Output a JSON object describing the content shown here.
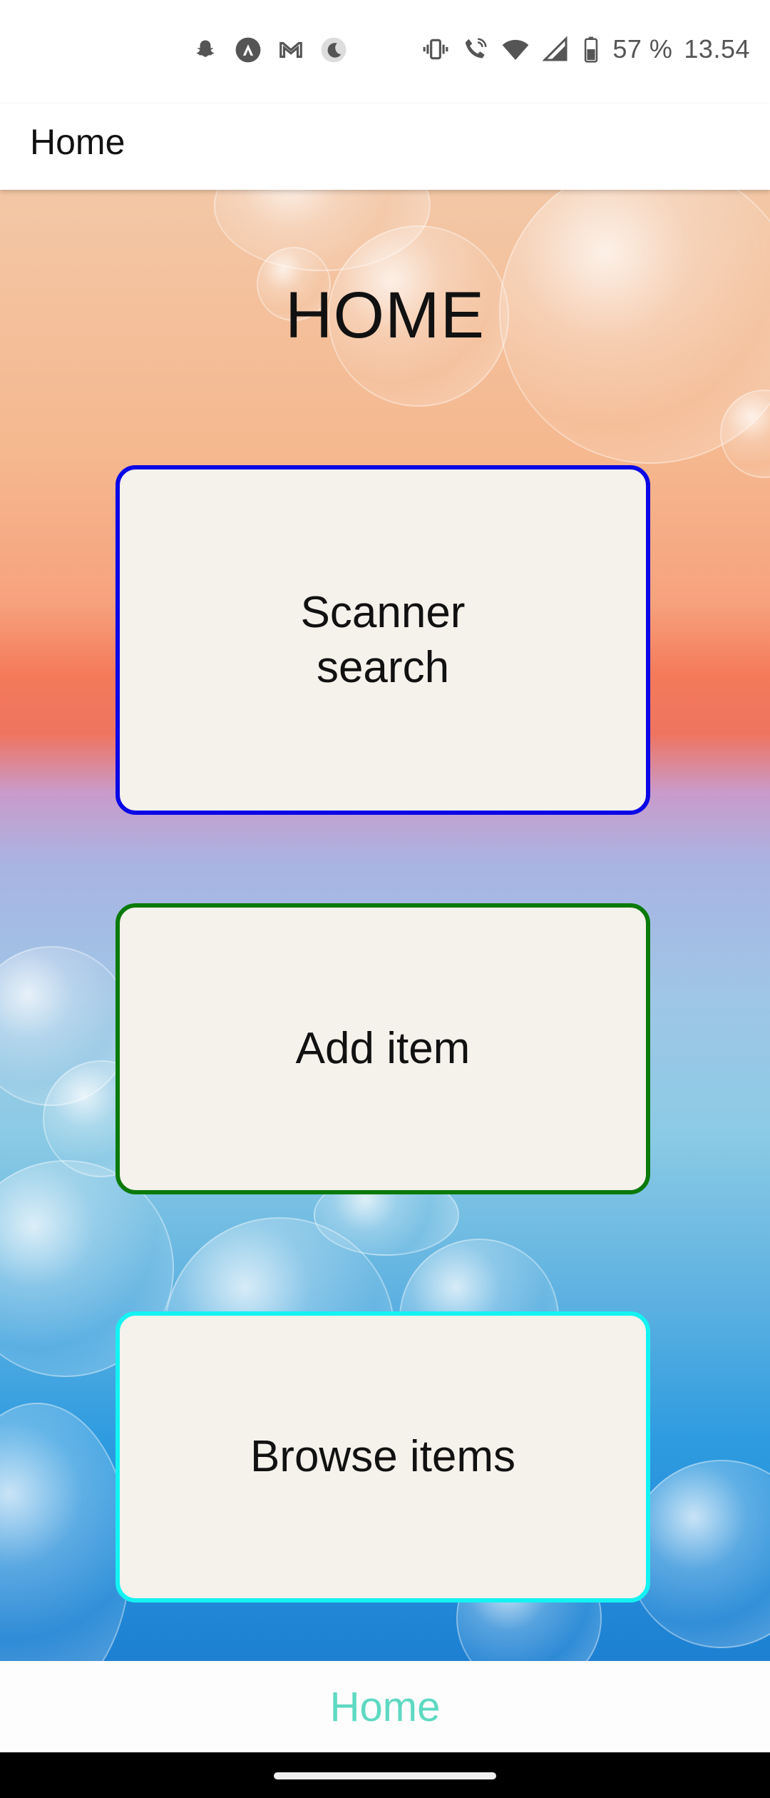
{
  "status_bar": {
    "battery": "57 %",
    "time": "13.54",
    "left_icons": [
      "snapchat-icon",
      "app-a-icon",
      "gmail-icon",
      "moon-icon"
    ],
    "right_icons": [
      "vibrate-icon",
      "wifi-call-icon",
      "wifi-icon",
      "signal-icon",
      "battery-icon"
    ]
  },
  "app_bar": {
    "title": "Home"
  },
  "main": {
    "heading": "HOME",
    "cards": [
      {
        "label": "Scanner\nsearch",
        "border_color": "#0a06e6"
      },
      {
        "label": "Add item",
        "border_color": "#0a7a0a"
      },
      {
        "label": "Browse items",
        "border_color": "#14f2f2"
      }
    ]
  },
  "bottom_nav": {
    "label": "Home",
    "color": "#5ed9c2"
  }
}
